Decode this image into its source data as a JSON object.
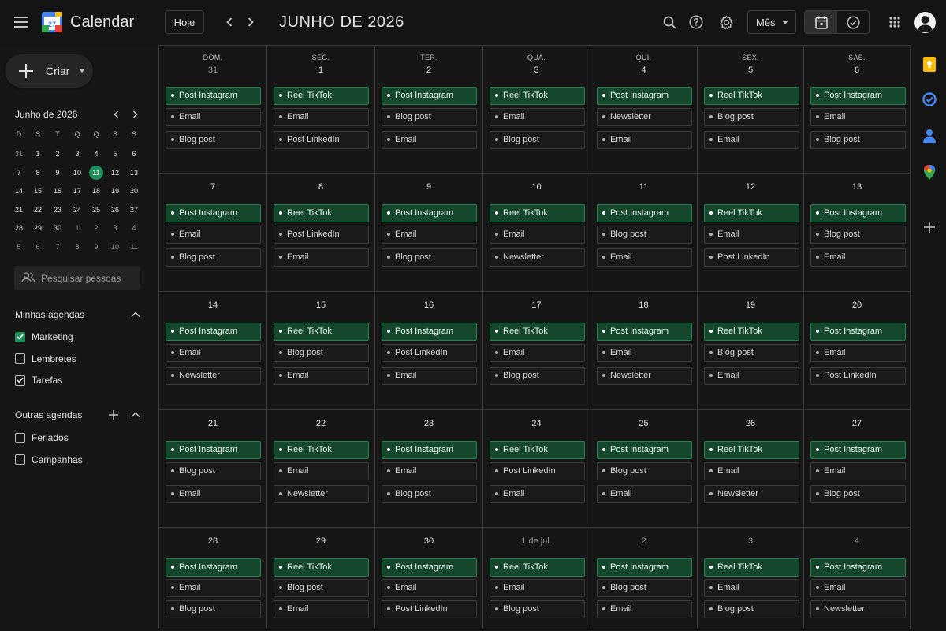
{
  "app": {
    "title": "Calendar",
    "logo_day": "27"
  },
  "toolbar": {
    "today_label": "Hoje",
    "month_title": "JUNHO DE 2026",
    "view_label": "Mês"
  },
  "sidebar": {
    "create_label": "Criar",
    "mini_calendar": {
      "title": "Junho de 2026",
      "weekdays": [
        "D",
        "S",
        "T",
        "Q",
        "Q",
        "S",
        "S"
      ],
      "weeks": [
        [
          {
            "d": "31",
            "o": true
          },
          {
            "d": "1"
          },
          {
            "d": "2"
          },
          {
            "d": "3"
          },
          {
            "d": "4"
          },
          {
            "d": "5"
          },
          {
            "d": "6"
          }
        ],
        [
          {
            "d": "7"
          },
          {
            "d": "8"
          },
          {
            "d": "9"
          },
          {
            "d": "10"
          },
          {
            "d": "11",
            "t": true
          },
          {
            "d": "12"
          },
          {
            "d": "13"
          }
        ],
        [
          {
            "d": "14"
          },
          {
            "d": "15"
          },
          {
            "d": "16"
          },
          {
            "d": "17"
          },
          {
            "d": "18"
          },
          {
            "d": "19"
          },
          {
            "d": "20"
          }
        ],
        [
          {
            "d": "21"
          },
          {
            "d": "22"
          },
          {
            "d": "23"
          },
          {
            "d": "24"
          },
          {
            "d": "25"
          },
          {
            "d": "26"
          },
          {
            "d": "27"
          }
        ],
        [
          {
            "d": "28"
          },
          {
            "d": "29"
          },
          {
            "d": "30"
          },
          {
            "d": "1",
            "o": true
          },
          {
            "d": "2",
            "o": true
          },
          {
            "d": "3",
            "o": true
          },
          {
            "d": "4",
            "o": true
          }
        ],
        [
          {
            "d": "5",
            "o": true
          },
          {
            "d": "6",
            "o": true
          },
          {
            "d": "7",
            "o": true
          },
          {
            "d": "8",
            "o": true
          },
          {
            "d": "9",
            "o": true
          },
          {
            "d": "10",
            "o": true
          },
          {
            "d": "11",
            "o": true
          }
        ]
      ]
    },
    "people_search_placeholder": "Pesquisar pessoas",
    "my_calendars_title": "Minhas agendas",
    "my_calendars": [
      {
        "label": "Marketing",
        "style": "green"
      },
      {
        "label": "Lembretes",
        "style": "empty"
      },
      {
        "label": "Tarefas",
        "style": "checked"
      }
    ],
    "other_calendars_title": "Outras agendas",
    "other_calendars": [
      {
        "label": "Feriados",
        "style": "empty"
      },
      {
        "label": "Campanhas",
        "style": "empty"
      }
    ]
  },
  "month": {
    "weekdays": [
      "DOM.",
      "SEG.",
      "TER.",
      "QUA.",
      "QUI.",
      "SEX.",
      "SÁB."
    ],
    "weeks": [
      [
        {
          "day": "31",
          "other": true,
          "events": [
            "Post Instagram",
            "Email",
            "Blog post"
          ]
        },
        {
          "day": "1",
          "events": [
            "Reel TikTok",
            "Email",
            "Post LinkedIn"
          ]
        },
        {
          "day": "2",
          "events": [
            "Post Instagram",
            "Blog post",
            "Email"
          ]
        },
        {
          "day": "3",
          "events": [
            "Reel TikTok",
            "Email",
            "Blog post"
          ]
        },
        {
          "day": "4",
          "events": [
            "Post Instagram",
            "Newsletter",
            "Email"
          ]
        },
        {
          "day": "5",
          "events": [
            "Reel TikTok",
            "Blog post",
            "Email"
          ]
        },
        {
          "day": "6",
          "events": [
            "Post Instagram",
            "Email",
            "Blog post"
          ]
        }
      ],
      [
        {
          "day": "7",
          "events": [
            "Post Instagram",
            "Email",
            "Blog post"
          ]
        },
        {
          "day": "8",
          "events": [
            "Reel TikTok",
            "Post LinkedIn",
            "Email"
          ]
        },
        {
          "day": "9",
          "events": [
            "Post Instagram",
            "Email",
            "Blog post"
          ]
        },
        {
          "day": "10",
          "events": [
            "Reel TikTok",
            "Email",
            "Newsletter"
          ]
        },
        {
          "day": "11",
          "events": [
            "Post Instagram",
            "Blog post",
            "Email"
          ]
        },
        {
          "day": "12",
          "events": [
            "Reel TikTok",
            "Email",
            "Post LinkedIn"
          ]
        },
        {
          "day": "13",
          "events": [
            "Post Instagram",
            "Blog post",
            "Email"
          ]
        }
      ],
      [
        {
          "day": "14",
          "events": [
            "Post Instagram",
            "Email",
            "Newsletter"
          ]
        },
        {
          "day": "15",
          "events": [
            "Reel TikTok",
            "Blog post",
            "Email"
          ]
        },
        {
          "day": "16",
          "events": [
            "Post Instagram",
            "Post LinkedIn",
            "Email"
          ]
        },
        {
          "day": "17",
          "events": [
            "Reel TikTok",
            "Email",
            "Blog post"
          ]
        },
        {
          "day": "18",
          "events": [
            "Post Instagram",
            "Email",
            "Newsletter"
          ]
        },
        {
          "day": "19",
          "events": [
            "Reel TikTok",
            "Blog post",
            "Email"
          ]
        },
        {
          "day": "20",
          "events": [
            "Post Instagram",
            "Email",
            "Post LinkedIn"
          ]
        }
      ],
      [
        {
          "day": "21",
          "events": [
            "Post Instagram",
            "Blog post",
            "Email"
          ]
        },
        {
          "day": "22",
          "events": [
            "Reel TikTok",
            "Email",
            "Newsletter"
          ]
        },
        {
          "day": "23",
          "events": [
            "Post Instagram",
            "Email",
            "Blog post"
          ]
        },
        {
          "day": "24",
          "events": [
            "Reel TikTok",
            "Post LinkedIn",
            "Email"
          ]
        },
        {
          "day": "25",
          "events": [
            "Post Instagram",
            "Blog post",
            "Email"
          ]
        },
        {
          "day": "26",
          "events": [
            "Reel TikTok",
            "Email",
            "Newsletter"
          ]
        },
        {
          "day": "27",
          "events": [
            "Post Instagram",
            "Email",
            "Blog post"
          ]
        }
      ],
      [
        {
          "day": "28",
          "events": [
            "Post Instagram",
            "Email",
            "Blog post"
          ]
        },
        {
          "day": "29",
          "events": [
            "Reel TikTok",
            "Blog post",
            "Email"
          ]
        },
        {
          "day": "30",
          "events": [
            "Post Instagram",
            "Email",
            "Post LinkedIn"
          ]
        },
        {
          "day": "1 de jul.",
          "other": true,
          "events": [
            "Reel TikTok",
            "Email",
            "Blog post"
          ]
        },
        {
          "day": "2",
          "other": true,
          "events": [
            "Post Instagram",
            "Blog post",
            "Email"
          ]
        },
        {
          "day": "3",
          "other": true,
          "events": [
            "Reel TikTok",
            "Email",
            "Blog post"
          ]
        },
        {
          "day": "4",
          "other": true,
          "events": [
            "Post Instagram",
            "Email",
            "Newsletter"
          ]
        }
      ]
    ]
  },
  "colors": {
    "accent": "#1e8e5a",
    "event_green_bg": "#14472b",
    "event_green_border": "#26804f",
    "grid_line": "#3a3a3a"
  },
  "icons": {
    "menu": "hamburger-icon",
    "search": "search-icon",
    "help": "help-icon",
    "settings": "gear-icon",
    "apps": "apps-grid-icon",
    "rail": [
      "keep-icon",
      "tasks-icon",
      "contacts-icon",
      "maps-icon",
      "add-icon"
    ]
  }
}
